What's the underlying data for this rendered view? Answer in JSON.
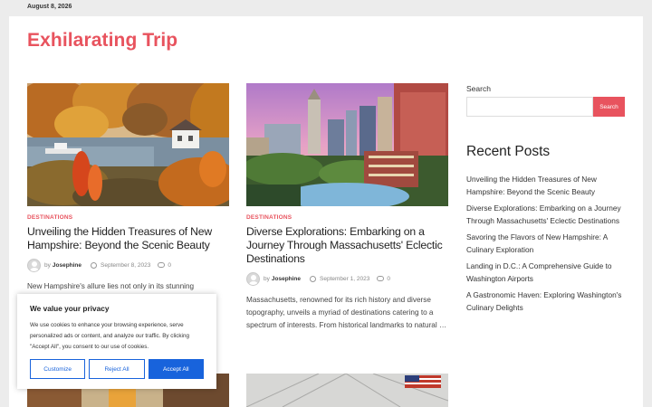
{
  "topbar": {
    "date": "August 8, 2026"
  },
  "site": {
    "title": "Exhilarating Trip"
  },
  "posts": [
    {
      "category": "DESTINATIONS",
      "title": "Unveiling the Hidden Treasures of New Hampshire: Beyond the Scenic Beauty",
      "by": "by",
      "author": "Josephine",
      "date": "September 8, 2023",
      "comments": "0",
      "excerpt": "New Hampshire's allure lies not only in its stunning landscapes but also in the hidden gems that lie hidden"
    },
    {
      "category": "DESTINATIONS",
      "title": "Diverse Explorations: Embarking on a Journey Through Massachusetts' Eclectic Destinations",
      "by": "by",
      "author": "Josephine",
      "date": "September 1, 2023",
      "comments": "0",
      "excerpt": "Massachusetts, renowned for its rich history and diverse topography, unveils a myriad of destinations catering to a spectrum of interests. From historical landmarks to natural …"
    }
  ],
  "sidebar": {
    "search_label": "Search",
    "search_button": "Search",
    "search_value": "",
    "recent_title": "Recent Posts",
    "recent": [
      "Unveiling the Hidden Treasures of New Hampshire: Beyond the Scenic Beauty",
      "Diverse Explorations: Embarking on a Journey Through Massachusetts' Eclectic Destinations",
      "Savoring the Flavors of New Hampshire: A Culinary Exploration",
      "Landing in D.C.: A Comprehensive Guide to Washington Airports",
      "A Gastronomic Haven: Exploring Washington's Culinary Delights"
    ]
  },
  "cookie": {
    "title": "We value your privacy",
    "text": "We use cookies to enhance your browsing experience, serve personalized ads or content, and analyze our traffic. By clicking \"Accept All\", you consent to our use of cookies.",
    "customize": "Customize",
    "reject": "Reject All",
    "accept": "Accept All"
  },
  "colors": {
    "accent": "#e8535e",
    "cookie_blue": "#1863dc"
  },
  "icons": [
    "avatar-icon",
    "clock-icon",
    "comment-icon"
  ]
}
